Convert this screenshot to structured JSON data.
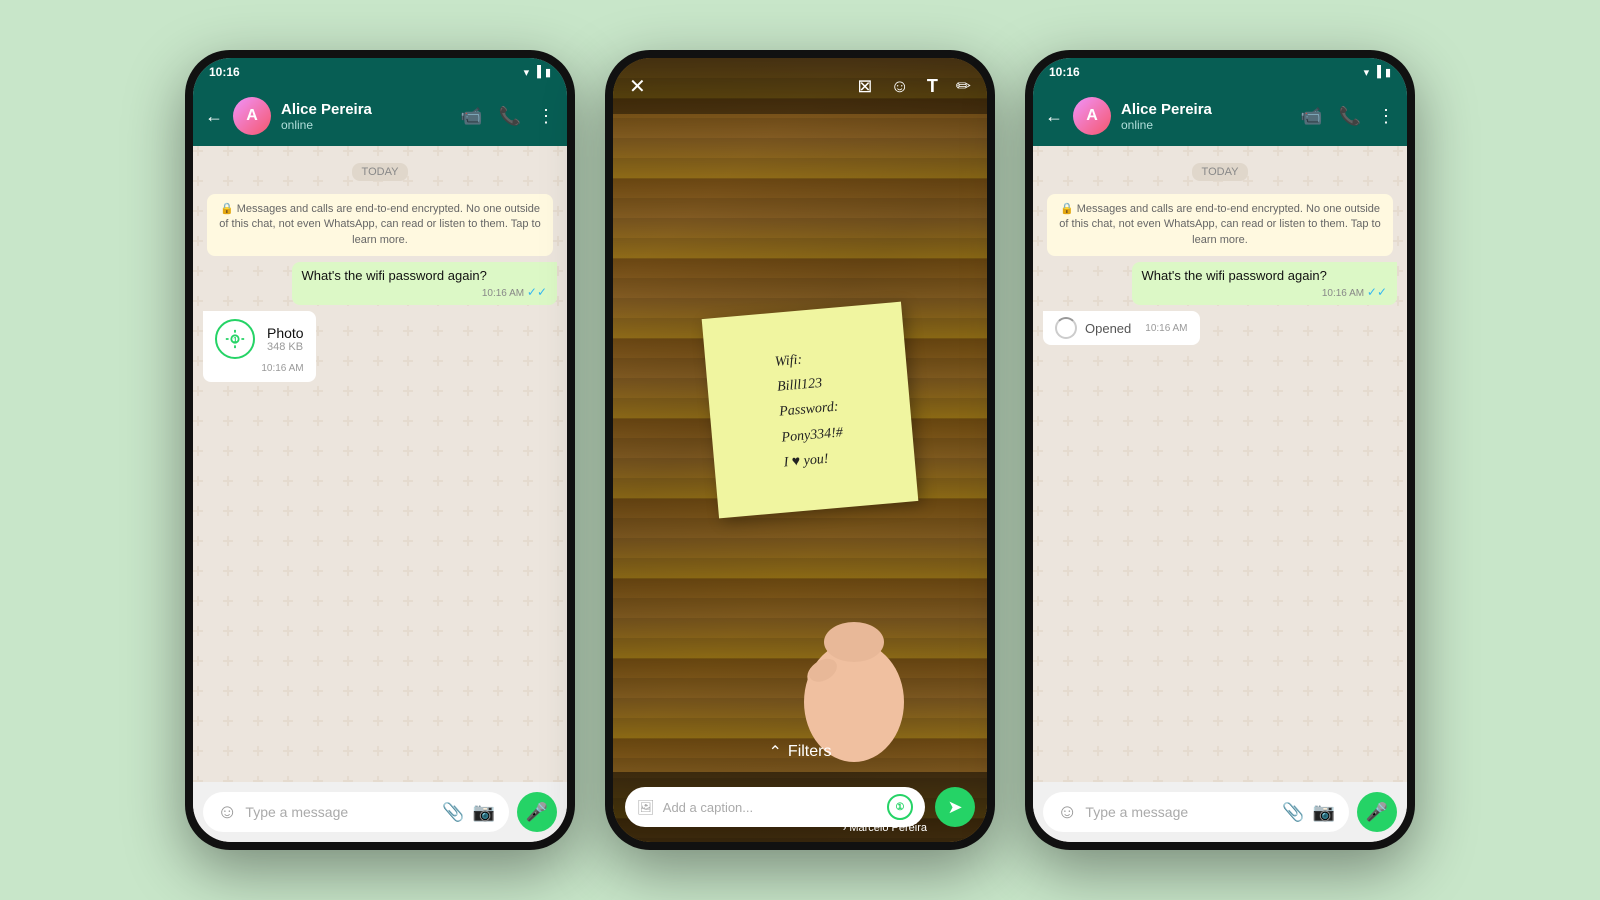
{
  "background": "#c8e6c9",
  "phones": [
    {
      "id": "phone-left",
      "type": "chat",
      "statusBar": {
        "time": "10:16",
        "icons": [
          "wifi",
          "signal",
          "battery"
        ]
      },
      "header": {
        "contactName": "Alice Pereira",
        "contactStatus": "online",
        "backButton": "←",
        "actions": [
          "video",
          "phone",
          "more"
        ]
      },
      "chat": {
        "dateBadge": "TODAY",
        "encryptionNotice": "🔒 Messages and calls are end-to-end encrypted. No one outside of this chat, not even WhatsApp, can read or listen to them. Tap to learn more.",
        "messages": [
          {
            "type": "outgoing",
            "text": "What's the wifi password again?",
            "time": "10:16 AM",
            "ticks": "✓✓"
          },
          {
            "type": "incoming",
            "subtype": "photo",
            "label": "Photo",
            "size": "348 KB",
            "time": "10:16 AM"
          }
        ],
        "inputPlaceholder": "Type a message"
      }
    },
    {
      "id": "phone-middle",
      "type": "media",
      "statusBar": {
        "time": "10:16"
      },
      "mediaViewer": {
        "tools": [
          "✕",
          "⬜",
          "☺",
          "T",
          "✏"
        ],
        "stickyNote": {
          "line1": "Wifi:",
          "line2": "Billl123",
          "line3": "Password:",
          "line4": "Pony334!#",
          "line5": "I ♥ you!"
        },
        "filtersLabel": "Filters",
        "captionPlaceholder": "Add a caption...",
        "recipient": "Marcelo Pereira",
        "sendIcon": "➤"
      }
    },
    {
      "id": "phone-right",
      "type": "chat",
      "statusBar": {
        "time": "10:16",
        "icons": [
          "wifi",
          "signal",
          "battery"
        ]
      },
      "header": {
        "contactName": "Alice Pereira",
        "contactStatus": "online",
        "backButton": "←",
        "actions": [
          "video",
          "phone",
          "more"
        ]
      },
      "chat": {
        "dateBadge": "TODAY",
        "encryptionNotice": "🔒 Messages and calls are end-to-end encrypted. No one outside of this chat, not even WhatsApp, can read or listen to them. Tap to learn more.",
        "messages": [
          {
            "type": "outgoing",
            "text": "What's the wifi password again?",
            "time": "10:16 AM",
            "ticks": "✓✓"
          },
          {
            "type": "incoming",
            "subtype": "opened",
            "label": "Opened",
            "time": "10:16 AM"
          }
        ],
        "inputPlaceholder": "Type a message"
      }
    }
  ],
  "icons": {
    "emoji": "☺",
    "attachment": "📎",
    "camera": "📷",
    "mic": "🎤",
    "video": "📹",
    "phone": "📞",
    "more": "⋮",
    "back": "←",
    "close": "✕",
    "crop": "⬛",
    "text": "T",
    "pencil": "✏",
    "chevronUp": "⌃",
    "send": "➤"
  }
}
